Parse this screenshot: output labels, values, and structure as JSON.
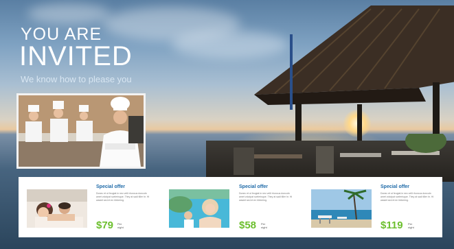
{
  "hero": {
    "line1": "YOU ARE",
    "line2": "INVITED",
    "tagline": "We know how to please you"
  },
  "offers": [
    {
      "title": "Special offer",
      "description": "Donec et ut feugiat in nec velit rhoncus doncutn amet volutpat scelerisque. They at sadi tiller hr. Hi wasiet sed et en hbbering.",
      "price": "$79",
      "per": "Per night"
    },
    {
      "title": "Special offer",
      "description": "Donec et ut feugiat in nec velit rhoncus doncutn amet volutpat scelerisque. They at sadi tiller hr. Hi wasiet sed et en hbbering.",
      "price": "$58",
      "per": "Per night"
    },
    {
      "title": "Special offer",
      "description": "Donec et ut feugiat in nec velit rhoncus doncutn amet volutpat scelerisque. They at sadi tiller hr. Hi wasiet sed et en hbbering.",
      "price": "$119",
      "per": "Per night"
    }
  ],
  "colors": {
    "offer_title": "#1e6aa8",
    "price": "#6cbf2e",
    "panel": "#ffffff"
  }
}
